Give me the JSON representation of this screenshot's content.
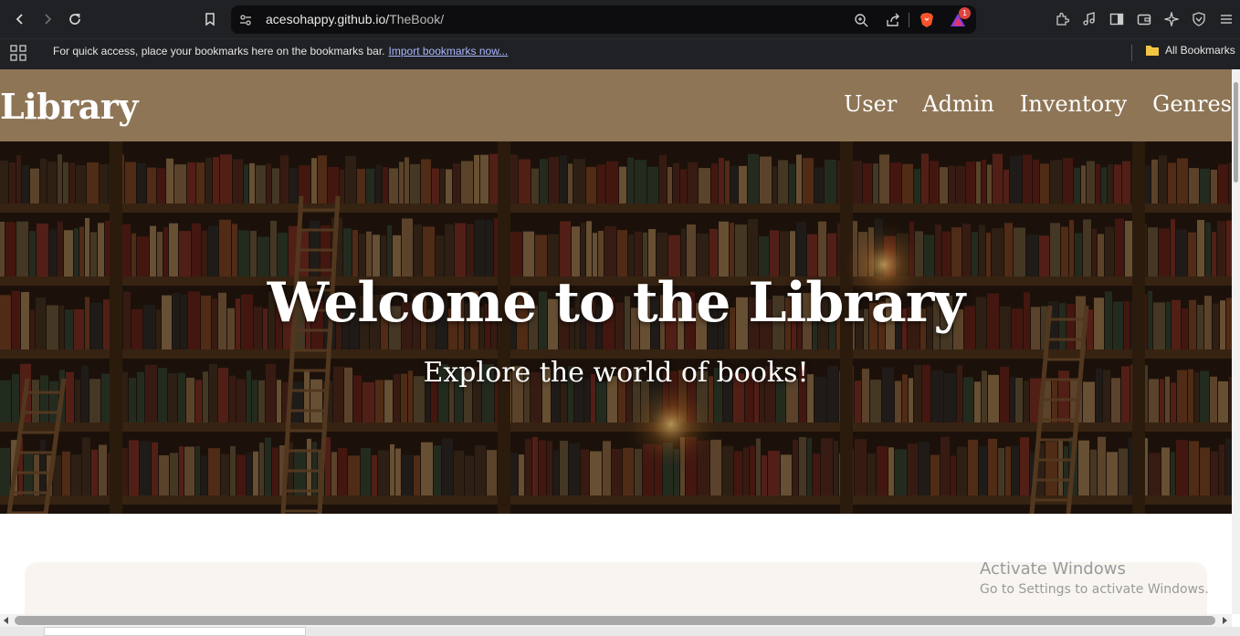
{
  "browser": {
    "url_domain": "acesohappy.github.io/",
    "url_path": "TheBook/",
    "notification_count": "1",
    "bookmarks_bar": {
      "message": "For quick access, place your bookmarks here on the bookmarks bar.",
      "import_link": "Import bookmarks now...",
      "all_bookmarks": "All Bookmarks"
    }
  },
  "site": {
    "logo": "Library",
    "nav": [
      "User",
      "Admin",
      "Inventory",
      "Genres"
    ],
    "hero_title": "Welcome to the Library",
    "hero_subtitle": "Explore the world of books!",
    "header_color": "#8e7556"
  },
  "watermark": {
    "title": "Activate Windows",
    "subtitle": "Go to Settings to activate Windows."
  }
}
